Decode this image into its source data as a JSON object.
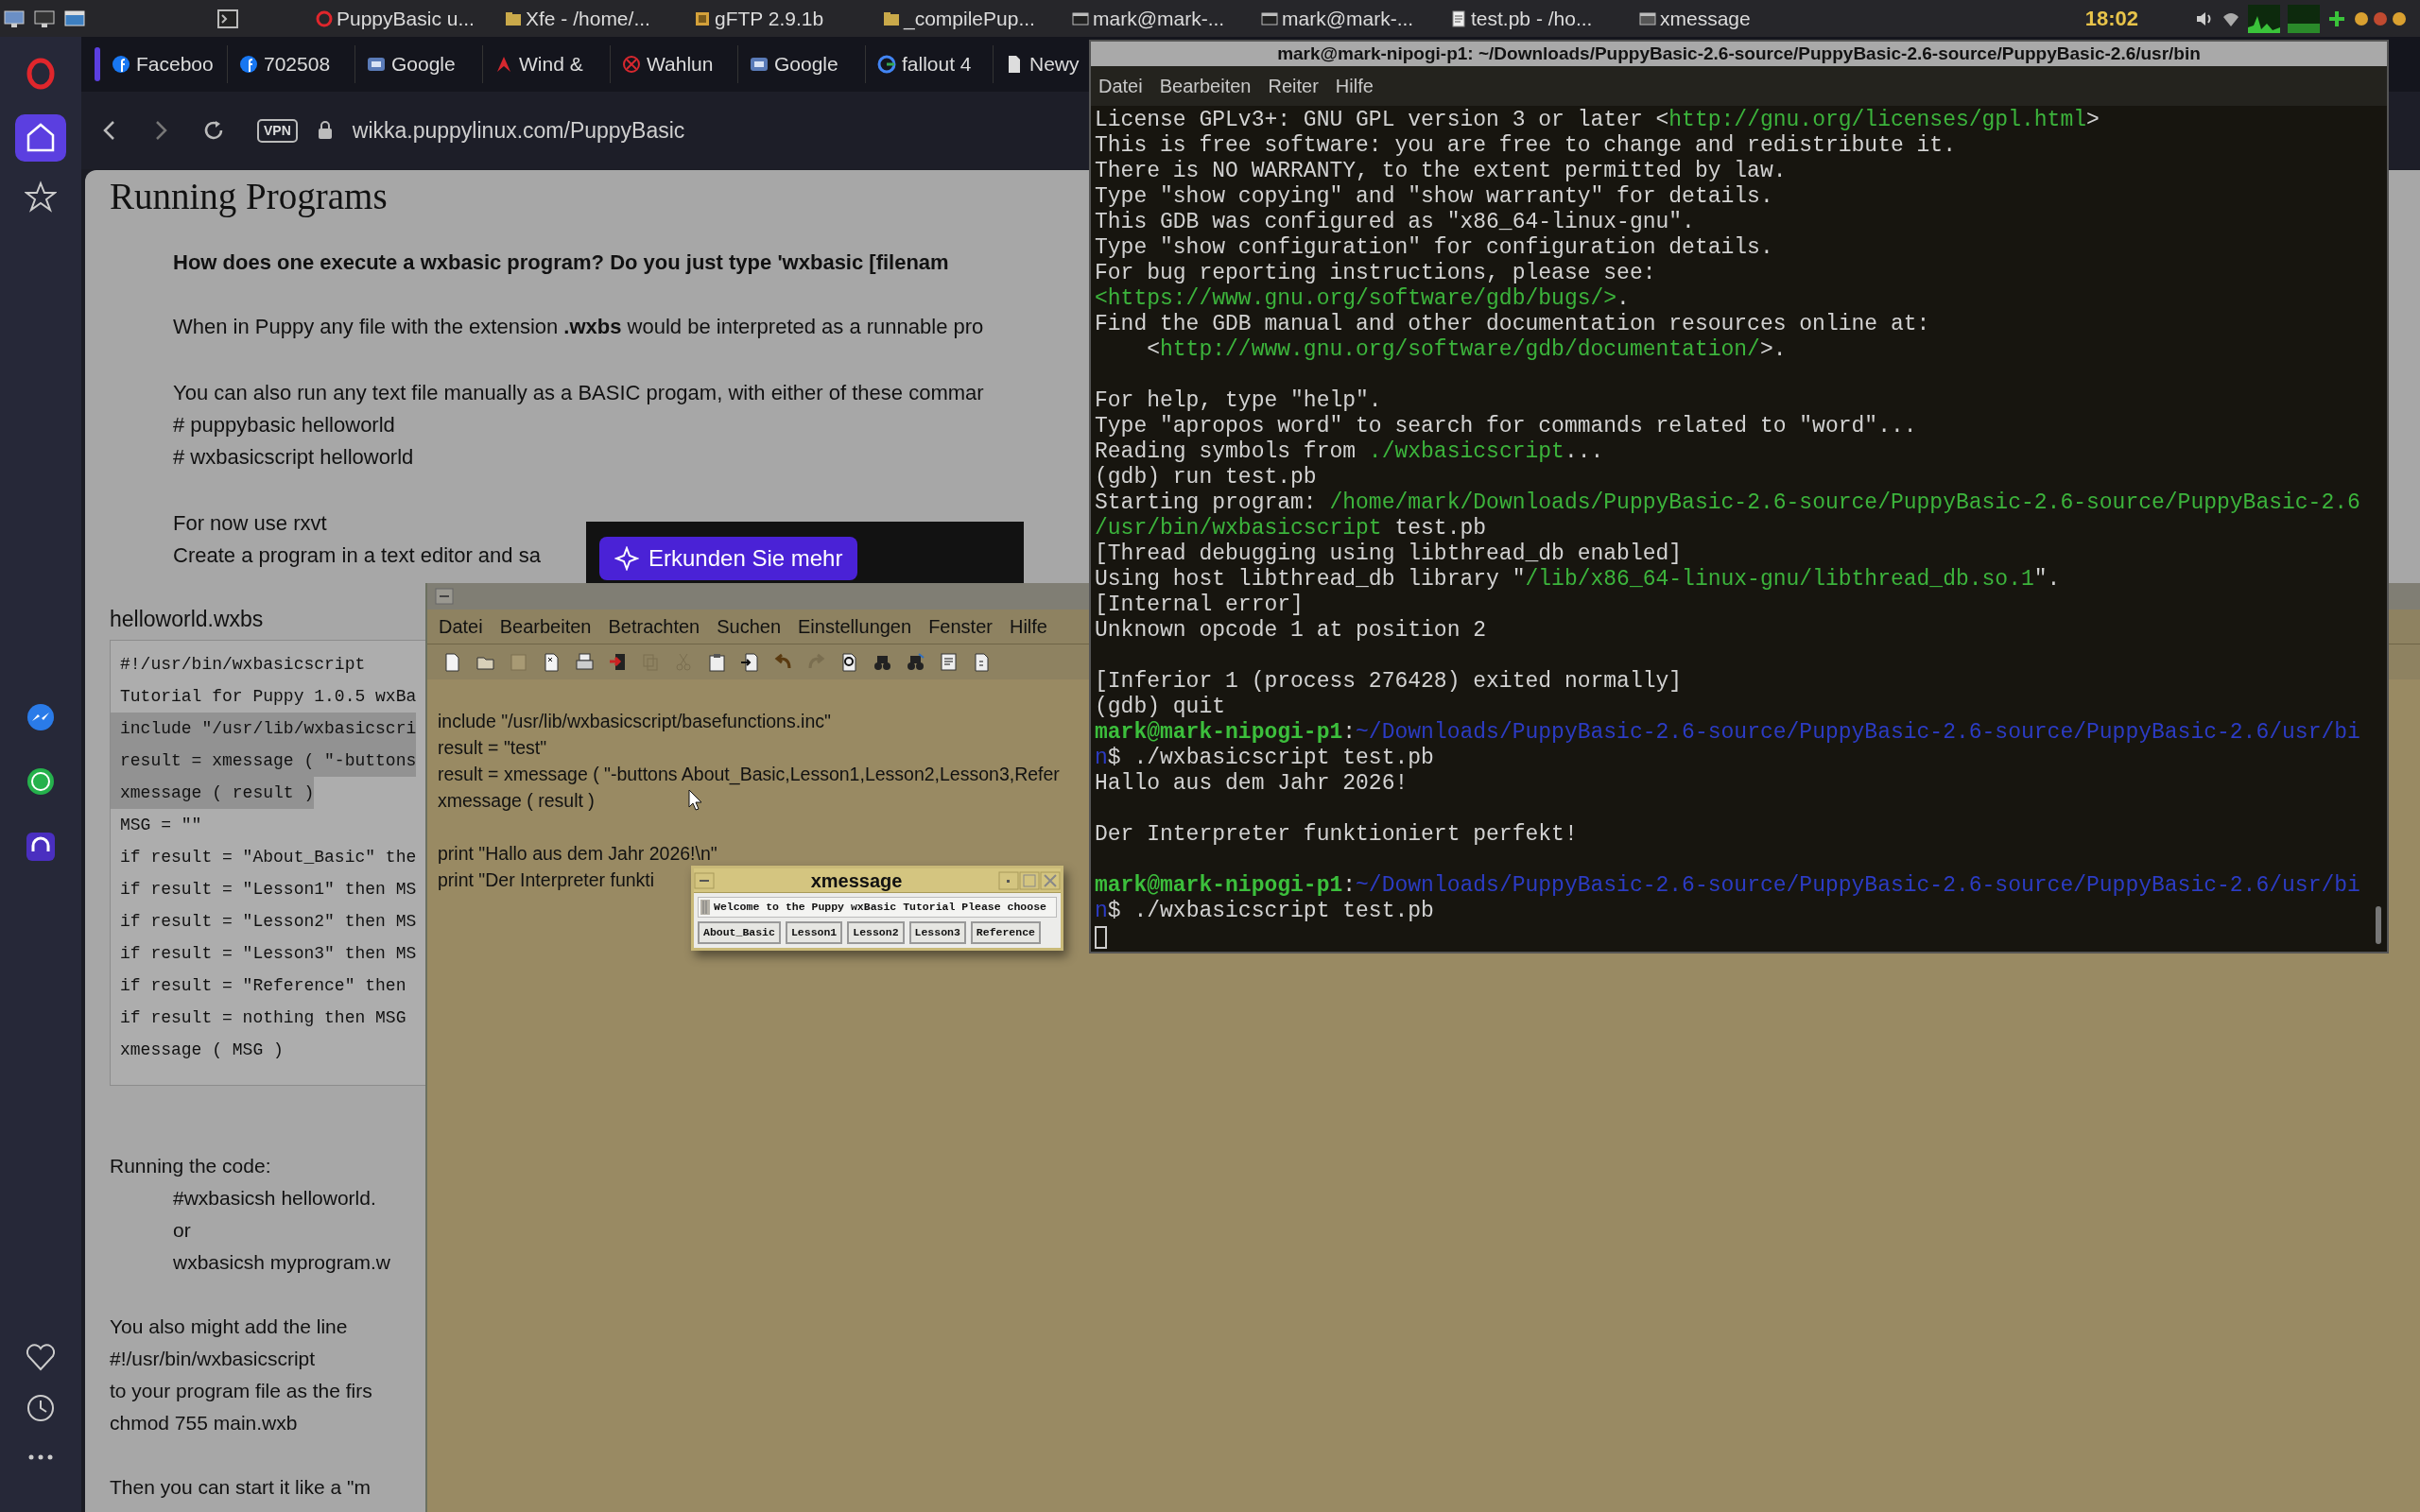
{
  "taskbar": {
    "items": [
      {
        "label": "PuppyBasic u...",
        "kind": "browser"
      },
      {
        "label": "Xfe - /home/...",
        "kind": "files"
      },
      {
        "label": "gFTP 2.9.1b",
        "kind": "ftp"
      },
      {
        "label": "_compilePup...",
        "kind": "files"
      },
      {
        "label": "mark@mark-...",
        "kind": "terminal"
      },
      {
        "label": "mark@mark-...",
        "kind": "terminal"
      },
      {
        "label": "test.pb - /ho...",
        "kind": "editor"
      },
      {
        "label": "xmessage",
        "kind": "window"
      }
    ],
    "clock": "18:02"
  },
  "browser": {
    "sidebar": [
      {
        "kind": "home",
        "selected": true
      },
      {
        "kind": "star",
        "selected": false
      },
      {
        "kind": "messenger",
        "selected": false
      },
      {
        "kind": "whatsapp",
        "selected": false
      },
      {
        "kind": "music",
        "selected": false
      },
      {
        "kind": "heart",
        "selected": false
      },
      {
        "kind": "clock",
        "selected": false
      },
      {
        "kind": "more",
        "selected": false
      }
    ],
    "tabs": [
      {
        "label": "Faceboo",
        "kind": "facebook"
      },
      {
        "label": "702508",
        "kind": "facebook"
      },
      {
        "label": "Google",
        "kind": "google-app"
      },
      {
        "label": "Wind &",
        "kind": "wind"
      },
      {
        "label": "Wahlun",
        "kind": "blocked"
      },
      {
        "label": "Google",
        "kind": "google-app"
      },
      {
        "label": "fallout 4",
        "kind": "google"
      },
      {
        "label": "Newy",
        "kind": "page"
      }
    ],
    "vpn": "VPN",
    "address": "wikka.puppylinux.com/PuppyBasic",
    "page": {
      "title": "Running Programs",
      "question": "How does one execute a wxbasic program? Do you just type 'wxbasic [filenam",
      "upper_paragraphs": [
        [
          "When in Puppy any file with the extension **.wxbs** would be interpreted as a runnable pro"
        ],
        [
          "You can also run any text file manually as a BASIC progam, with either of these commar",
          "# puppybasic helloworld",
          "# wxbasicscript helloworld"
        ],
        [
          "For now use rxvt",
          "Create a program in a text editor and sa"
        ]
      ],
      "promo_button": "Erkunden Sie mehr",
      "code_title": "helloworld.wxbs",
      "code_lines": [
        {
          "text": "#!/usr/bin/wxbasicscript",
          "highlighted": false
        },
        {
          "text": "Tutorial for Puppy 1.0.5 wxBa",
          "highlighted": false
        },
        {
          "text": "include \"/usr/lib/wxbasicscri",
          "highlighted": true
        },
        {
          "text": "result = xmessage ( \"-buttons",
          "highlighted": true
        },
        {
          "text": "xmessage ( result )",
          "highlighted": true
        },
        {
          "text": "MSG = \"\"",
          "highlighted": false
        },
        {
          "text": "if result = \"About_Basic\" the",
          "highlighted": false
        },
        {
          "text": "if result = \"Lesson1\" then MS",
          "highlighted": false
        },
        {
          "text": "if result = \"Lesson2\" then MS",
          "highlighted": false
        },
        {
          "text": "if result = \"Lesson3\" then MS",
          "highlighted": false
        },
        {
          "text": "if result = \"Reference\" then",
          "highlighted": false
        },
        {
          "text": "if result = nothing then MSG",
          "highlighted": false
        },
        {
          "text": "xmessage ( MSG )",
          "highlighted": false
        }
      ],
      "running_code": {
        "label": "Running the code:",
        "commands": [
          "#wxbasicsh helloworld.",
          "or",
          "wxbasicsh myprogram.w"
        ]
      },
      "lower_paragraphs": [
        [
          "You also might add the line",
          "#!/usr/bin/wxbasicscript",
          "to your program file as the firs",
          "chmod 755 main.wxb"
        ],
        [
          "Then you can start it like a \"m"
        ]
      ]
    }
  },
  "editor": {
    "menu": [
      "Datei",
      "Bearbeiten",
      "Betrachten",
      "Suchen",
      "Einstellungen",
      "Fenster",
      "Hilfe"
    ],
    "blocks": [
      [
        "include \"/usr/lib/wxbasicscript/basefunctions.inc\"",
        "result = \"test\"",
        "result = xmessage ( \"-buttons About_Basic,Lesson1,Lesson2,Lesson3,Refer",
        "xmessage ( result )"
      ],
      [
        "print \"Hallo aus dem Jahr 2026!\\n\"",
        "print \"Der Interpreter funkti"
      ]
    ]
  },
  "xmessage": {
    "title": "xmessage",
    "message": "Welcome to the Puppy wxBasic Tutorial Please choose",
    "buttons": [
      "About_Basic",
      "Lesson1",
      "Lesson2",
      "Lesson3",
      "Reference"
    ]
  },
  "terminal": {
    "title": "mark@mark-nipogi-p1: ~/Downloads/PuppyBasic-2.6-source/PuppyBasic-2.6-source/PuppyBasic-2.6/usr/bin",
    "menu": [
      "Datei",
      "Bearbeiten",
      "Reiter",
      "Hilfe"
    ],
    "blocks": [
      [
        [
          {
            "text": "License GPLv3+: GNU GPL version 3 or later <",
            "kind": "plain"
          },
          {
            "text": "http://gnu.org/licenses/gpl.html",
            "kind": "link"
          },
          {
            "text": ">",
            "kind": "plain"
          }
        ],
        [
          {
            "text": "This is free software: you are free to change and redistribute it.",
            "kind": "plain"
          }
        ],
        [
          {
            "text": "There is NO WARRANTY, to the extent permitted by law.",
            "kind": "plain"
          }
        ],
        [
          {
            "text": "Type \"show copying\" and \"show warranty\" for details.",
            "kind": "plain"
          }
        ],
        [
          {
            "text": "This GDB was configured as \"x86_64-linux-gnu\".",
            "kind": "plain"
          }
        ],
        [
          {
            "text": "Type \"show configuration\" for configuration details.",
            "kind": "plain"
          }
        ],
        [
          {
            "text": "For bug reporting instructions, please see:",
            "kind": "plain"
          }
        ],
        [
          {
            "text": "<https://www.gnu.org/software/gdb/bugs/>",
            "kind": "link"
          },
          {
            "text": ".",
            "kind": "plain"
          }
        ],
        [
          {
            "text": "Find the GDB manual and other documentation resources online at:",
            "kind": "plain"
          }
        ],
        [
          {
            "text": "    <",
            "kind": "plain"
          },
          {
            "text": "http://www.gnu.org/software/gdb/documentation/",
            "kind": "link"
          },
          {
            "text": ">.",
            "kind": "plain"
          }
        ]
      ],
      [
        [
          {
            "text": "For help, type \"help\".",
            "kind": "plain"
          }
        ],
        [
          {
            "text": "Type \"apropos word\" to search for commands related to \"word\"...",
            "kind": "plain"
          }
        ],
        [
          {
            "text": "Reading symbols from ",
            "kind": "plain"
          },
          {
            "text": "./wxbasicscript",
            "kind": "link"
          },
          {
            "text": "...",
            "kind": "plain"
          }
        ],
        [
          {
            "text": "(gdb) run test.pb",
            "kind": "plain"
          }
        ],
        [
          {
            "text": "Starting program: ",
            "kind": "plain"
          },
          {
            "text": "/home/mark/Downloads/PuppyBasic-2.6-source/PuppyBasic-2.6-source/PuppyBasic-2.6",
            "kind": "link"
          }
        ],
        [
          {
            "text": "/usr/bin/wxbasicscript",
            "kind": "link"
          },
          {
            "text": " test.pb",
            "kind": "plain"
          }
        ],
        [
          {
            "text": "[Thread debugging using libthread_db enabled]",
            "kind": "plain"
          }
        ],
        [
          {
            "text": "Using host libthread_db library \"",
            "kind": "plain"
          },
          {
            "text": "/lib/x86_64-linux-gnu/libthread_db.so.1",
            "kind": "link"
          },
          {
            "text": "\".",
            "kind": "plain"
          }
        ],
        [
          {
            "text": "[Internal error]",
            "kind": "plain"
          }
        ],
        [
          {
            "text": "Unknown opcode 1 at position 2",
            "kind": "plain"
          }
        ]
      ],
      [
        [
          {
            "text": "[Inferior 1 (process 276428) exited normally]",
            "kind": "plain"
          }
        ],
        [
          {
            "text": "(gdb) quit",
            "kind": "plain"
          }
        ],
        [
          {
            "text": "mark@mark-nipogi-p1",
            "kind": "user"
          },
          {
            "text": ":",
            "kind": "plain"
          },
          {
            "text": "~/Downloads/PuppyBasic-2.6-source/PuppyBasic-2.6-source/PuppyBasic-2.6/usr/bi",
            "kind": "path"
          }
        ],
        [
          {
            "text": "n",
            "kind": "path"
          },
          {
            "text": "$ ./wxbasicscript test.pb",
            "kind": "plain"
          }
        ],
        [
          {
            "text": "Hallo aus dem Jahr 2026!",
            "kind": "plain"
          }
        ]
      ],
      [
        [
          {
            "text": "Der Interpreter funktioniert perfekt!",
            "kind": "plain"
          }
        ]
      ],
      [
        [
          {
            "text": "mark@mark-nipogi-p1",
            "kind": "user"
          },
          {
            "text": ":",
            "kind": "plain"
          },
          {
            "text": "~/Downloads/PuppyBasic-2.6-source/PuppyBasic-2.6-source/PuppyBasic-2.6/usr/bi",
            "kind": "path"
          }
        ],
        [
          {
            "text": "n",
            "kind": "path"
          },
          {
            "text": "$ ./wxbasicscript test.pb",
            "kind": "plain"
          }
        ]
      ]
    ]
  }
}
